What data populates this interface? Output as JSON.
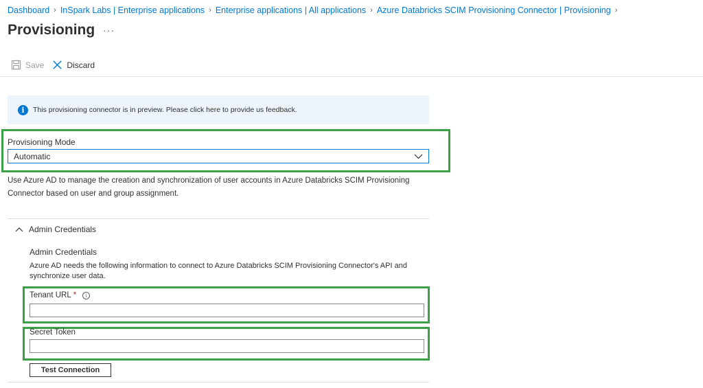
{
  "breadcrumb": [
    {
      "label": "Dashboard"
    },
    {
      "label": "InSpark Labs | Enterprise applications"
    },
    {
      "label": "Enterprise applications | All applications"
    },
    {
      "label": "Azure Databricks SCIM Provisioning Connector | Provisioning"
    }
  ],
  "page": {
    "title": "Provisioning",
    "more": "···"
  },
  "toolbar": {
    "save_label": "Save",
    "discard_label": "Discard"
  },
  "banner": {
    "text": "This provisioning connector is in preview. Please click here to provide us feedback."
  },
  "provisioning_mode": {
    "label": "Provisioning Mode",
    "selected": "Automatic",
    "description": "Use Azure AD to manage the creation and synchronization of user accounts in Azure Databricks SCIM Provisioning Connector based on user and group assignment."
  },
  "admin_credentials": {
    "section_label": "Admin Credentials",
    "title": "Admin Credentials",
    "description": "Azure AD needs the following information to connect to Azure Databricks SCIM Provisioning Connector's API and synchronize user data.",
    "tenant_url_label": "Tenant URL",
    "required_mark": "*",
    "tenant_url_value": "",
    "secret_token_label": "Secret Token",
    "secret_token_value": "",
    "test_button_label": "Test Connection"
  },
  "colors": {
    "accent": "#0078d4",
    "highlight": "#3aa144",
    "banner_bg": "#eef4fb"
  }
}
